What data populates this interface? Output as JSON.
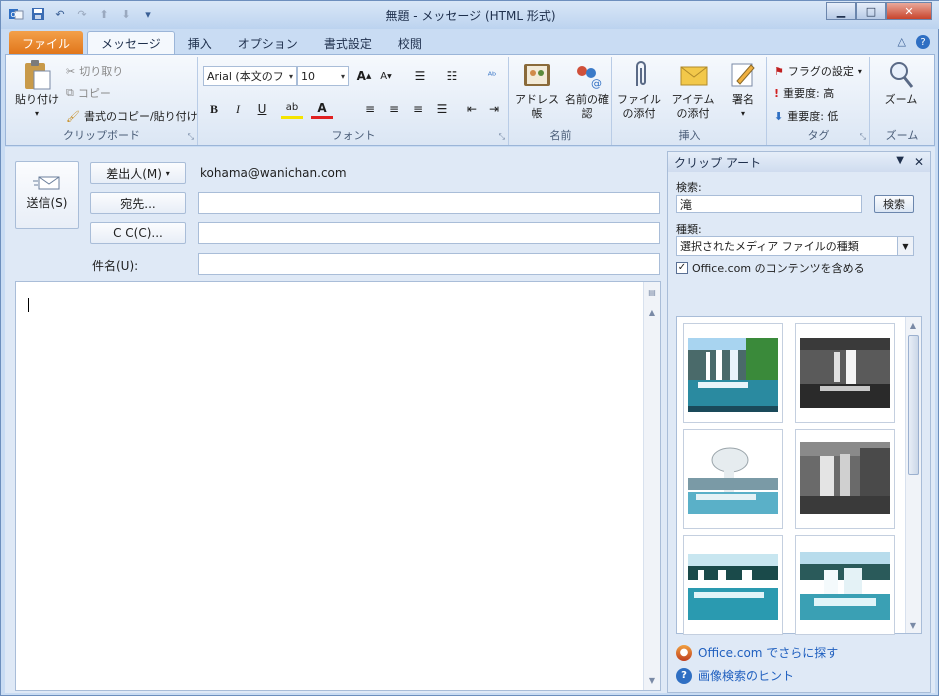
{
  "window": {
    "title": "無題 - メッセージ (HTML 形式)"
  },
  "tabs": [
    {
      "label": "ファイル"
    },
    {
      "label": "メッセージ"
    },
    {
      "label": "挿入"
    },
    {
      "label": "オプション"
    },
    {
      "label": "書式設定"
    },
    {
      "label": "校閲"
    }
  ],
  "ribbon": {
    "clipboard": {
      "paste": "貼り付け",
      "cut": "切り取り",
      "copy": "コピー",
      "format_painter": "書式のコピー/貼り付け",
      "label": "クリップボード"
    },
    "font": {
      "font_name": "Arial (本文のフ",
      "font_size": "10",
      "label": "フォント"
    },
    "names": {
      "address_book": "アドレス帳",
      "check_names": "名前の確認",
      "label": "名前"
    },
    "include": {
      "attach_file": "ファイルの添付",
      "attach_item": "アイテムの添付",
      "signature": "署名",
      "label": "挿入"
    },
    "tags": {
      "follow_up": "フラグの設定",
      "high_importance": "重要度: 高",
      "low_importance": "重要度: 低",
      "label": "タグ"
    },
    "zoom": {
      "zoom": "ズーム",
      "label": "ズーム"
    }
  },
  "compose": {
    "send": "送信(S)",
    "from_button": "差出人(M)",
    "from_value": "kohama@wanichan.com",
    "to_button": "宛先...",
    "cc_button": "C C(C)...",
    "subject_label": "件名(U):",
    "to_value": "",
    "cc_value": "",
    "subject_value": ""
  },
  "clipart": {
    "title": "クリップ アート",
    "search_label": "検索:",
    "search_value": "滝",
    "search_button": "検索",
    "type_label": "種類:",
    "type_value": "選択されたメディア ファイルの種類",
    "include_office": "Office.com のコンテンツを含める",
    "include_office_checked": true,
    "more_link": "Office.com でさらに探す",
    "hint_link": "画像検索のヒント"
  },
  "colors": {
    "file_tab": "#e07418",
    "accent": "#1f5fbf"
  }
}
